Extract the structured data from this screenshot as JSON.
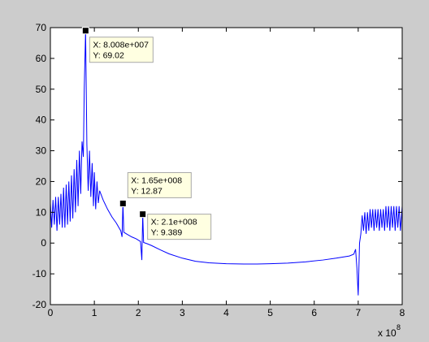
{
  "colors": {
    "figure_bg": "#cccccc",
    "axes_bg": "#ffffff",
    "line": "#0000ff",
    "datatip_bg": "#ffffe1",
    "marker": "#000000"
  },
  "chart_data": {
    "type": "line",
    "title": "",
    "xlabel": "",
    "ylabel": "",
    "x_exponent_label": "x 10",
    "x_exponent_power": "8",
    "xlim": [
      0,
      8
    ],
    "ylim": [
      -20,
      70
    ],
    "xticks": [
      "0",
      "1",
      "2",
      "3",
      "4",
      "5",
      "6",
      "7",
      "8"
    ],
    "yticks": [
      "70",
      "60",
      "50",
      "40",
      "30",
      "20",
      "10",
      "0",
      "-10",
      "-20"
    ],
    "grid": false,
    "legend": "none",
    "series": [
      {
        "x_unit_scale": 100000000,
        "points": [
          [
            0.0,
            13
          ],
          [
            0.03,
            5
          ],
          [
            0.06,
            14
          ],
          [
            0.09,
            6
          ],
          [
            0.12,
            15
          ],
          [
            0.15,
            4
          ],
          [
            0.18,
            15
          ],
          [
            0.21,
            6
          ],
          [
            0.24,
            16
          ],
          [
            0.27,
            5
          ],
          [
            0.3,
            18
          ],
          [
            0.33,
            5
          ],
          [
            0.36,
            19
          ],
          [
            0.39,
            6
          ],
          [
            0.42,
            20
          ],
          [
            0.45,
            7
          ],
          [
            0.48,
            22
          ],
          [
            0.51,
            8
          ],
          [
            0.54,
            24
          ],
          [
            0.57,
            10
          ],
          [
            0.6,
            27
          ],
          [
            0.63,
            12
          ],
          [
            0.66,
            30
          ],
          [
            0.69,
            16
          ],
          [
            0.72,
            33
          ],
          [
            0.75,
            28
          ],
          [
            0.77,
            50
          ],
          [
            0.8008,
            69.02
          ],
          [
            0.83,
            32
          ],
          [
            0.86,
            17
          ],
          [
            0.89,
            30
          ],
          [
            0.92,
            15
          ],
          [
            0.95,
            26
          ],
          [
            0.98,
            12
          ],
          [
            1.0,
            23
          ],
          [
            1.03,
            11
          ],
          [
            1.06,
            20
          ],
          [
            1.09,
            13
          ],
          [
            1.12,
            17
          ],
          [
            1.2,
            14
          ],
          [
            1.3,
            11
          ],
          [
            1.4,
            8.5
          ],
          [
            1.5,
            6.5
          ],
          [
            1.6,
            4
          ],
          [
            1.63,
            2
          ],
          [
            1.65,
            12.87
          ],
          [
            1.67,
            3.5
          ],
          [
            1.75,
            2.8
          ],
          [
            1.85,
            2.0
          ],
          [
            1.95,
            1.4
          ],
          [
            2.05,
            0.5
          ],
          [
            2.08,
            -5.5
          ],
          [
            2.1,
            9.389
          ],
          [
            2.12,
            0.2
          ],
          [
            2.2,
            -0.2
          ],
          [
            2.3,
            -0.8
          ],
          [
            2.5,
            -2.2
          ],
          [
            2.7,
            -3.5
          ],
          [
            3.0,
            -4.9
          ],
          [
            3.3,
            -5.9
          ],
          [
            3.6,
            -6.4
          ],
          [
            4.0,
            -6.7
          ],
          [
            4.4,
            -6.8
          ],
          [
            4.7,
            -6.8
          ],
          [
            5.0,
            -6.7
          ],
          [
            5.4,
            -6.5
          ],
          [
            5.8,
            -6.1
          ],
          [
            6.2,
            -5.5
          ],
          [
            6.5,
            -4.9
          ],
          [
            6.8,
            -4.2
          ],
          [
            6.9,
            -3.6
          ],
          [
            6.94,
            -2
          ],
          [
            6.97,
            -8
          ],
          [
            7.0,
            -17
          ],
          [
            7.03,
            0
          ],
          [
            7.06,
            3
          ],
          [
            7.09,
            9
          ],
          [
            7.12,
            4
          ],
          [
            7.15,
            10
          ],
          [
            7.18,
            3
          ],
          [
            7.21,
            10
          ],
          [
            7.24,
            4
          ],
          [
            7.27,
            11
          ],
          [
            7.3,
            5
          ],
          [
            7.33,
            11
          ],
          [
            7.36,
            4
          ],
          [
            7.39,
            11
          ],
          [
            7.42,
            5
          ],
          [
            7.45,
            11
          ],
          [
            7.48,
            4
          ],
          [
            7.51,
            11
          ],
          [
            7.54,
            5
          ],
          [
            7.57,
            11
          ],
          [
            7.6,
            4
          ],
          [
            7.63,
            12
          ],
          [
            7.66,
            5
          ],
          [
            7.69,
            12
          ],
          [
            7.72,
            4
          ],
          [
            7.75,
            12
          ],
          [
            7.78,
            5
          ],
          [
            7.81,
            12
          ],
          [
            7.84,
            4
          ],
          [
            7.87,
            12
          ],
          [
            7.9,
            5
          ],
          [
            7.93,
            12
          ],
          [
            7.96,
            4
          ],
          [
            8.0,
            12
          ]
        ]
      }
    ],
    "annotations": [
      {
        "x": 0.8008,
        "y": 69.02,
        "line1": "X: 8.008e+007",
        "line2": "Y: 69.02",
        "placement": "below-right"
      },
      {
        "x": 1.65,
        "y": 12.87,
        "line1": "X: 1.65e+008",
        "line2": "Y: 12.87",
        "placement": "above-right"
      },
      {
        "x": 2.1,
        "y": 9.389,
        "line1": "X: 2.1e+008",
        "line2": "Y: 9.389",
        "placement": "right"
      }
    ]
  }
}
